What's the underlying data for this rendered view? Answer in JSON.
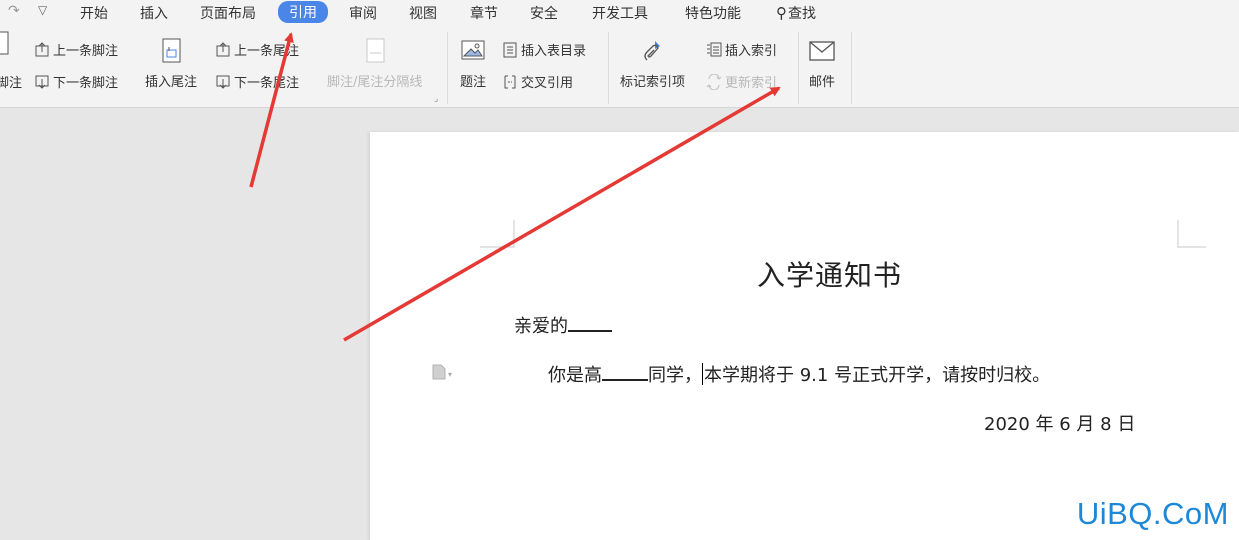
{
  "menubar": {
    "tabs": [
      "开始",
      "插入",
      "页面布局",
      "引用",
      "审阅",
      "视图",
      "章节",
      "安全",
      "开发工具",
      "特色功能"
    ],
    "active_tab": "引用",
    "search_label": "查找"
  },
  "ribbon": {
    "footnote_label": "脚注",
    "prev_footnote": "上一条脚注",
    "next_footnote": "下一条脚注",
    "insert_endnote": "插入尾注",
    "prev_endnote": "上一条尾注",
    "next_endnote": "下一条尾注",
    "separator_line": "脚注/尾注分隔线",
    "caption": "题注",
    "insert_toc": "插入表目录",
    "cross_ref": "交叉引用",
    "mark_index": "标记索引项",
    "insert_index": "插入索引",
    "update_index": "更新索引",
    "mail": "邮件"
  },
  "document": {
    "title": "入学通知书",
    "greeting": "亲爱的",
    "body_prefix": "你是高",
    "body_mid": "同学，",
    "body_rest": "本学期将于 9.1 号正式开学，请按时归校。",
    "date": "2020 年 6 月 8 日"
  },
  "watermark": "UiBQ.CoM",
  "colors": {
    "accent": "#4a86e8",
    "arrow": "#e53935",
    "watermark": "#1e88d8"
  }
}
